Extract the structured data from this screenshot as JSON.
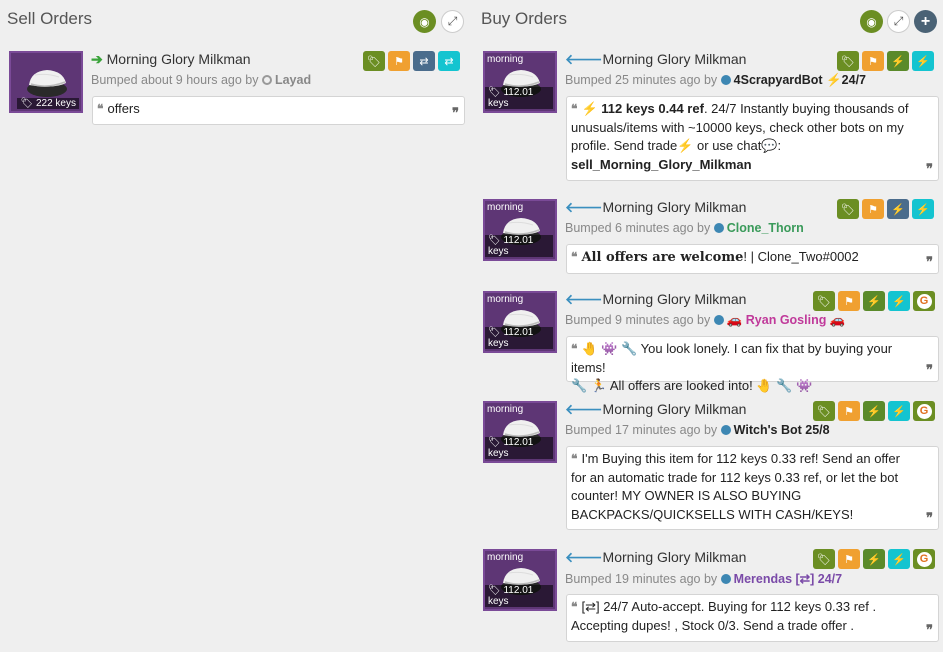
{
  "sell": {
    "title": "Sell Orders",
    "listing": {
      "item_name": "Morning Glory Milkman",
      "price": "222 keys",
      "bumped_prefix": "Bumped about 9 hours ago by",
      "user": "Layad",
      "user_color": "#888888",
      "message": "offers"
    }
  },
  "buy": {
    "title": "Buy Orders",
    "listings": [
      {
        "item_name": "Morning Glory Milkman",
        "img_tag": "morning",
        "price": "112.01 keys",
        "bumped_prefix": "Bumped 25 minutes ago by",
        "user": "4ScrapyardBot",
        "user_suffix": "24/7",
        "user_color": "#222222",
        "msg_price": "112 keys 0.44 ref",
        "msg_text": ". 24/7 Instantly buying thousands of unusuals/items with ~10000 keys, check other bots on my profile. Send  trade",
        "msg_or": " or  use  chat",
        "msg_cmd": "sell_Morning_Glory_Milkman"
      },
      {
        "item_name": "Morning Glory Milkman",
        "img_tag": "morning",
        "price": "112.01 keys",
        "bumped_prefix": "Bumped 6 minutes ago by",
        "user": "Clone_Thorn",
        "user_color": "#3a9a5a",
        "msg_bold": "All offers are welcome",
        "msg_text": "! | Clone_Two#0002"
      },
      {
        "item_name": "Morning Glory Milkman",
        "img_tag": "morning",
        "price": "112.01 keys",
        "bumped_prefix": "Bumped 9 minutes ago by",
        "user": "Ryan Gosling",
        "user_color": "#c0399a",
        "msg_text": "You look lonely. I can fix that by buying your items!",
        "msg_text2": "All offers are looked into!"
      },
      {
        "item_name": "Morning Glory Milkman",
        "img_tag": "morning",
        "price": "112.01 keys",
        "bumped_prefix": "Bumped 17 minutes ago by",
        "user": "Witch's Bot 25/8",
        "user_color": "#222222",
        "msg_text": "I'm Buying this item for 112 keys 0.33 ref! Send an offer for an automatic trade for 112 keys 0.33 ref, or let the bot counter! MY OWNER IS ALSO BUYING BACKPACKS/QUICKSELLS WITH CASH/KEYS!"
      },
      {
        "item_name": "Morning Glory Milkman",
        "img_tag": "morning",
        "price": "112.01 keys",
        "bumped_prefix": "Bumped 19 minutes ago by",
        "user": "Merendas [⇄] 24/7",
        "user_color": "#7a4aa8",
        "msg_text": "[⇄] 24/7 Auto-accept. Buying for 112 keys 0.33 ref . Accepting dupes! , Stock 0/3. Send a trade offer ."
      }
    ]
  }
}
